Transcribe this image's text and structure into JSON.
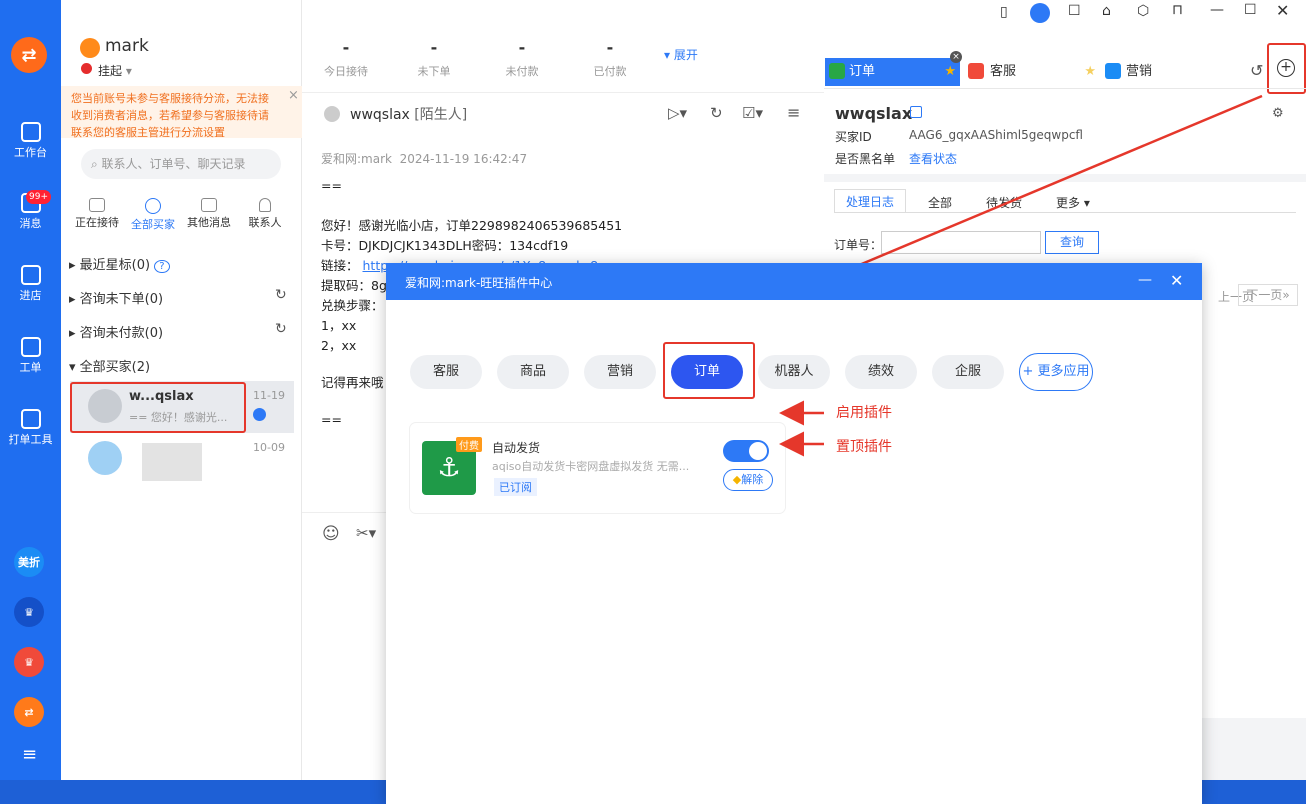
{
  "window": {
    "title_icons": [
      "phone-icon",
      "headset-icon",
      "note-icon",
      "shirt-icon",
      "settings-hex-icon",
      "pin-icon",
      "minimize-icon",
      "maximize-icon",
      "close-icon"
    ]
  },
  "nav": {
    "items": [
      {
        "label": "工作台",
        "icon": "workbench-icon"
      },
      {
        "label": "消息",
        "icon": "message-icon",
        "badge": "99+"
      },
      {
        "label": "进店",
        "icon": "store-icon"
      },
      {
        "label": "工单",
        "icon": "ticket-icon"
      },
      {
        "label": "打单工具",
        "icon": "print-icon"
      }
    ],
    "apps": [
      {
        "label": "美折",
        "color": "#1b8cf5"
      },
      {
        "label": "♛",
        "color": "#1450c8"
      },
      {
        "label": "♛",
        "color": "#f04a3a"
      },
      {
        "label": "⇄",
        "color": "#ff7a1a"
      }
    ],
    "menu": "≡"
  },
  "user": {
    "name": "mark",
    "status": "挂起"
  },
  "notice": "您当前账号未参与客服接待分流，无法接收到消费者消息，若希望参与客服接待请联系您的客服主管进行分流设置",
  "search": {
    "placeholder": "联系人、订单号、聊天记录"
  },
  "subtabs": [
    "正在接待",
    "全部买家",
    "其他消息",
    "联系人"
  ],
  "groups": [
    {
      "label": "最近星标(0)"
    },
    {
      "label": "咨询未下单(0)"
    },
    {
      "label": "咨询未付款(0)"
    },
    {
      "label": "全部买家(2)"
    }
  ],
  "contacts": [
    {
      "name": "w...qslax",
      "preview": "== 您好！感谢光...",
      "date": "11-19"
    },
    {
      "name": "",
      "preview": "",
      "date": "10-09"
    }
  ],
  "stats": [
    {
      "value": "-",
      "label": "今日接待"
    },
    {
      "value": "-",
      "label": "未下单"
    },
    {
      "value": "-",
      "label": "未付款"
    },
    {
      "value": "-",
      "label": "已付款"
    }
  ],
  "expand": "展开",
  "chat": {
    "contact": "wwqslax",
    "tag": "[陌生人]",
    "sender": "爱和网:mark",
    "time": "2024-11-19 16:42:47",
    "lines": [
      "==",
      "",
      "您好！感谢光临小店，订单2298982406539685451",
      "卡号：DJKDJCJK1343DLH密码：134cdf19",
      "链接：",
      "提取码：8g",
      "兑换步骤：",
      "1，xx",
      "2，xx",
      "",
      "记得再来哦",
      "",
      "=="
    ],
    "link": "https://pan.baixx.com/s/1Xy8xpwd=8gsx"
  },
  "right": {
    "tabs": [
      "订单",
      "客服",
      "营销"
    ],
    "buyer": {
      "name": "wwqslax",
      "id_label": "买家ID",
      "id": "AAG6_gqxAAShiml5geqwpcfl",
      "black_label": "是否黑名单",
      "black_link": "查看状态"
    },
    "subtabs": [
      "处理日志",
      "全部",
      "待发货",
      "更多"
    ],
    "order_label": "订单号：",
    "query": "查询",
    "pager": [
      "上一页",
      "下一页»"
    ]
  },
  "dialog": {
    "title": "爱和网:mark-旺旺插件中心",
    "cats": [
      "客服",
      "商品",
      "营销",
      "订单",
      "机器人",
      "绩效",
      "企服",
      "+ 更多应用"
    ],
    "active": "订单",
    "plugin": {
      "paid": "付费",
      "name": "自动发货",
      "desc": "aqiso自动发货卡密网盘虚拟发货 无需...",
      "status": "已订阅",
      "unpin": "解除",
      "enabled": true
    }
  },
  "annotations": [
    "启用插件",
    "置顶插件"
  ],
  "colors": {
    "brand": "#2d79f6",
    "accent_red": "#e5372b",
    "nav": "#1f6ef0"
  }
}
